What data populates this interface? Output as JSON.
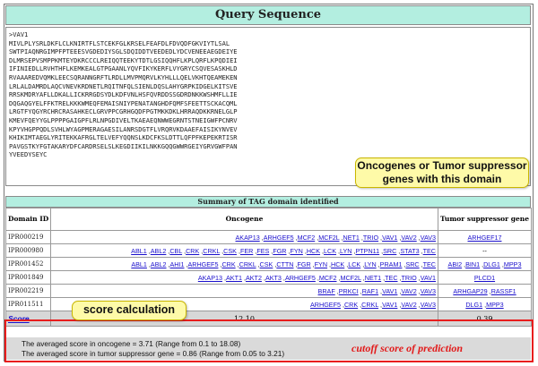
{
  "query": {
    "title": "Query Sequence",
    "sequence": ">VAV1\nMIVLPLYSRLDKFLCLKNIRTFLSTCEKFGLKRSELFEAFDLFDVQDFGKVIYTLSAL\nSWTPIAQNRGIMPFPTEEESVGDEDIYSGLSDQIDDTVEEDEDLYDCVENEEAEGDEIYE\nDLMRSEPVSMPPKMTEYDKRCCCLREIQQTEEKYTDTLGSIQQHFLKPLQRFLKPQDIEI\nIFINIEDLLRVHTHFLKEMKEALGTPGAANLYQVFIKYKERFLVYGRYCSQVESASKHLD\nRVAAAREDVQMKLEECSQRANNGRFTLRDLLMVPMQRVLKYHLLLQELVKHTQEAMEKEN\nLRLALDAMRDLAQCVNEVKRDNETLRQITNFQLSIENLDQSLAHYGRPKIDGELKITSVE\nRRSKMDRYAFLLDKALLICKRRGDSYDLKDFVNLHSFQVRDDSSGDRDNKKWSHMFLLIE\nDQGAQGYELFFKTRELKKKWMEQFEMAISNIYPENATANGHDFQMFSFEETTSCKACQML\nLRGTFYQGYRCHRCRASAHKECLGRVPPCGRHGQDFPGTMKKDKLHRRAQDKKRNELGLP\nKMEVFQEYYGLPPPPGAIGPFLRLNPGDIVELTKAEAEQNWWEGRNTSTNEIGWFPCNRV\nKPYVHGPPQDLSVHLWYAGPMERAGAESILANRSDGTFLVRQRVKDAAEFAISIKYNVEV\nKHIKIMTAEGLYRITEKKAFRGLTELVEFYQQNSLKDCFKSLDTTLQFPFKEPEKRTISR\nPAVGSTKYFGTAKARYDFCARDRSELSLKEGDIIKILNKKGQQGWWRGEIYGRVGWFPAN\nYVEEDYSEYC"
  },
  "callouts": {
    "oncogenes_line1": "Oncogenes or Tumor suppressor",
    "oncogenes_line2": "genes with this domain",
    "score": "score calculation",
    "cutoff": "cutoff score of prediction"
  },
  "summary": {
    "title": "Summary of TAG domain identified",
    "headers": {
      "domain_id": "Domain ID",
      "oncogene": "Oncogene",
      "tumor": "Tumor suppressor gene"
    },
    "rows": [
      {
        "id": "IPR000219",
        "oncogenes": [
          "AKAP13",
          "ARHGEF5",
          "MCF2",
          "MCF2L",
          "NET1",
          "TRIO",
          "VAV1",
          "VAV2",
          "VAV3"
        ],
        "tumor": [
          "ARHGEF17"
        ]
      },
      {
        "id": "IPR000980",
        "oncogenes": [
          "ABL1",
          "ABL2",
          "CBL",
          "CRK",
          "CRKL",
          "CSK",
          "FER",
          "FES",
          "FGR",
          "FYN",
          "HCK",
          "LCK",
          "LYN",
          "PTPN11",
          "SRC",
          "STAT3",
          "TEC"
        ],
        "tumor": [
          "--"
        ]
      },
      {
        "id": "IPR001452",
        "oncogenes": [
          "ABL1",
          "ABL2",
          "AHI1",
          "ARHGEF5",
          "CRK",
          "CRKL",
          "CSK",
          "CTTN",
          "FGR",
          "FYN",
          "HCK",
          "LCK",
          "LYN",
          "PRAM1",
          "SRC",
          "TEC"
        ],
        "tumor": [
          "ABI2",
          "BIN1",
          "DLG1",
          "MPP3"
        ]
      },
      {
        "id": "IPR001849",
        "oncogenes": [
          "AKAP13",
          "AKT1",
          "AKT2",
          "AKT3",
          "ARHGEF5",
          "MCF2",
          "MCF2L",
          "NET1",
          "TEC",
          "TRIO",
          "VAV1"
        ],
        "tumor": [
          "PLCD1"
        ]
      },
      {
        "id": "IPR002219",
        "oncogenes": [
          "BRAF",
          "PRKCI",
          "RAF1",
          "VAV1",
          "VAV2",
          "VAV3"
        ],
        "tumor": [
          "ARHGAP29",
          "RASSF1"
        ]
      },
      {
        "id": "IPR011511",
        "oncogenes": [
          "ARHGEF5",
          "CRK",
          "CRKL",
          "VAV1",
          "VAV2",
          "VAV3"
        ],
        "tumor": [
          "DLG1",
          "MPP3"
        ]
      }
    ],
    "score_label": "Score",
    "score_oncogene": "12.10",
    "score_tumor": "0.39",
    "avg_oncogene": "The averaged score in oncogene = 3.71 (Range from 0.1 to 18.08)",
    "avg_tumor": "The averaged score in tumor suppressor gene = 0.86 (Range from 0.05 to 3.21)"
  },
  "colors": {
    "header_bg": "#b3eee0",
    "link": "#1a0fcc",
    "callout_bg": "#fefaa8",
    "highlight_red": "#e81d1d"
  }
}
